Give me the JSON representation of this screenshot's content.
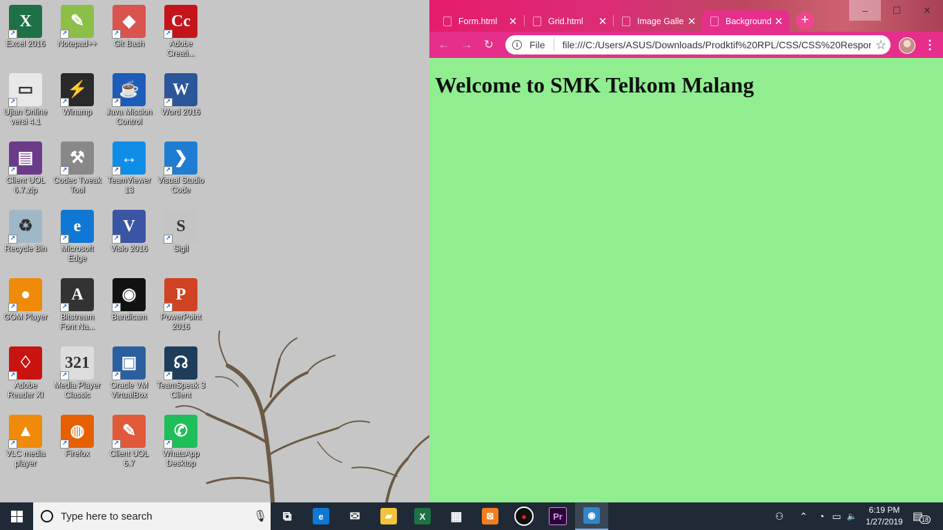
{
  "desktop": {
    "icons": [
      {
        "label": "Excel 2016",
        "glyph": "X",
        "color": "#1e7145"
      },
      {
        "label": "Notepad++",
        "glyph": "✎",
        "color": "#8bbf48"
      },
      {
        "label": "Git Bash",
        "glyph": "◆",
        "color": "#d9534f"
      },
      {
        "label": "Adobe Creati...",
        "glyph": "Cc",
        "color": "#c4151c"
      },
      {
        "label": "Ujian Online versi 4.1",
        "glyph": "▭",
        "color": "#e8e8e8"
      },
      {
        "label": "Winamp",
        "glyph": "⚡",
        "color": "#2a2a2a"
      },
      {
        "label": "Java Mission Control",
        "glyph": "☕",
        "color": "#1d5cb8"
      },
      {
        "label": "Word 2016",
        "glyph": "W",
        "color": "#2b579a"
      },
      {
        "label": "Client UOL 6.7.zip",
        "glyph": "▤",
        "color": "#6b3b8a"
      },
      {
        "label": "Codec Tweak Tool",
        "glyph": "⚒",
        "color": "#888888"
      },
      {
        "label": "TeamViewer 13",
        "glyph": "↔",
        "color": "#0e8ee9"
      },
      {
        "label": "Visual Studio Code",
        "glyph": "❯",
        "color": "#1e7dd2"
      },
      {
        "label": "Recycle Bin",
        "glyph": "♻",
        "color": "#9fb8c8"
      },
      {
        "label": "Microsoft Edge",
        "glyph": "e",
        "color": "#0f78d4"
      },
      {
        "label": "Visio 2016",
        "glyph": "V",
        "color": "#3955a3"
      },
      {
        "label": "Sigil",
        "glyph": "S",
        "color": "#c4c4c4"
      },
      {
        "label": "GOM Player",
        "glyph": "●",
        "color": "#f08a0a"
      },
      {
        "label": "Bitstream Font Na...",
        "glyph": "A",
        "color": "#333333"
      },
      {
        "label": "Bandicam",
        "glyph": "◉",
        "color": "#111111"
      },
      {
        "label": "PowerPoint 2016",
        "glyph": "P",
        "color": "#d04423"
      },
      {
        "label": "Adobe Reader XI",
        "glyph": "♢",
        "color": "#c8130f"
      },
      {
        "label": "Media Player Classic",
        "glyph": "321",
        "color": "#dddddd"
      },
      {
        "label": "Oracle VM VirtualBox",
        "glyph": "▣",
        "color": "#2c5f9e"
      },
      {
        "label": "TeamSpeak 3 Client",
        "glyph": "☊",
        "color": "#1d3d5b"
      },
      {
        "label": "VLC media player",
        "glyph": "▲",
        "color": "#f08a0a"
      },
      {
        "label": "Firefox",
        "glyph": "◍",
        "color": "#e66000"
      },
      {
        "label": "Client UOL 6.7",
        "glyph": "✎",
        "color": "#e05a3a"
      },
      {
        "label": "WhatsApp Desktop",
        "glyph": "✆",
        "color": "#1ebe5a"
      }
    ]
  },
  "browser": {
    "tabs": [
      {
        "title": "Form.html",
        "active": false
      },
      {
        "title": "Grid.html",
        "active": false
      },
      {
        "title": "Image Galle",
        "active": false
      },
      {
        "title": "Background",
        "active": true
      }
    ],
    "close_glyph": "✕",
    "new_tab_glyph": "+",
    "window_controls": {
      "minimize": "–",
      "maximize": "☐",
      "close": "✕"
    },
    "nav": {
      "back": "←",
      "forward": "→",
      "reload": "↻"
    },
    "address": {
      "scheme_label": "File",
      "url": "file:///C:/Users/ASUS/Downloads/Prodktif%20RPL/CSS/CSS%20Respon..."
    },
    "menu_glyph": "⋮",
    "page": {
      "heading": "Welcome to SMK Telkom Malang",
      "background": "#90ee90"
    }
  },
  "taskbar": {
    "search_placeholder": "Type here to search",
    "apps": [
      {
        "name": "task-view",
        "glyph": "⧉",
        "color": "transparent",
        "active": false
      },
      {
        "name": "edge",
        "glyph": "e",
        "color": "#0f78d4",
        "active": false
      },
      {
        "name": "mail",
        "glyph": "✉",
        "color": "transparent",
        "active": false
      },
      {
        "name": "file-explorer",
        "glyph": "▰",
        "color": "#f3c33d",
        "active": false
      },
      {
        "name": "excel",
        "glyph": "X",
        "color": "#1e7145",
        "active": false
      },
      {
        "name": "store",
        "glyph": "▦",
        "color": "transparent",
        "active": false
      },
      {
        "name": "xampp",
        "glyph": "⊠",
        "color": "#f37d22",
        "active": false
      },
      {
        "name": "bandicam",
        "glyph": "●",
        "color": "#111111",
        "active": false
      },
      {
        "name": "premiere",
        "glyph": "Pr",
        "color": "#2a0634",
        "active": false
      },
      {
        "name": "chrome",
        "glyph": "◉",
        "color": "#2f86c8",
        "active": true
      }
    ],
    "tray": {
      "people": "⚇",
      "chevron": "⌃",
      "wifi": "◔",
      "battery": "▭",
      "volume": "🔈"
    },
    "clock": {
      "time": "6:19 PM",
      "date": "1/27/2019"
    },
    "notification_count": "18"
  }
}
